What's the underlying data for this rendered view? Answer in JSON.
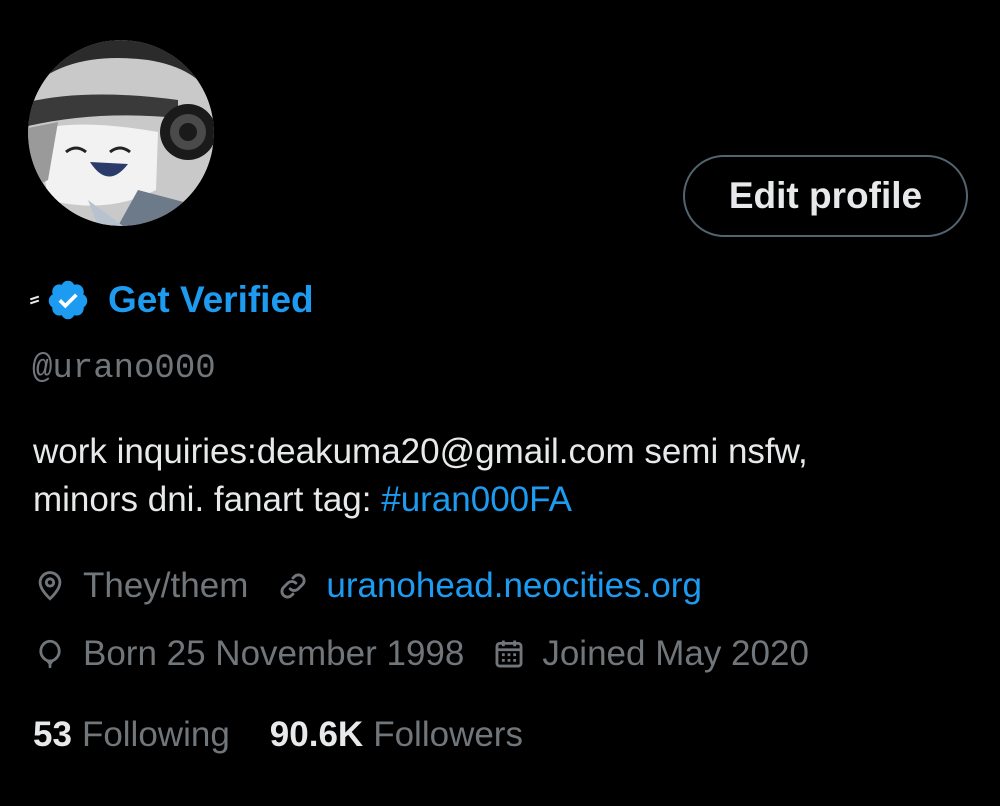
{
  "profile": {
    "edit_button_label": "Edit profile",
    "get_verified_label": "Get Verified",
    "handle": "@urano000",
    "bio": {
      "text_line1": "work inquiries:deakuma20@gmail.com semi nsfw,",
      "text_line2": "minors dni. fanart tag: ",
      "hashtag": "#uran000FA"
    },
    "pronouns": "They/them",
    "website": "uranohead.neocities.org",
    "birthday": "Born 25 November 1998",
    "joined": "Joined May 2020",
    "stats": {
      "following_count": "53",
      "following_label": "Following",
      "followers_count": "90.6K",
      "followers_label": "Followers"
    },
    "icons": {
      "verified": "verified-badge-icon",
      "pronouns": "location-pin-icon",
      "website": "link-icon",
      "birthday": "balloon-icon",
      "joined": "calendar-icon"
    }
  },
  "colors": {
    "background": "#000000",
    "text_primary": "#e7e9ea",
    "text_secondary": "#71767b",
    "accent": "#1d9bf0",
    "button_border": "#536471"
  }
}
